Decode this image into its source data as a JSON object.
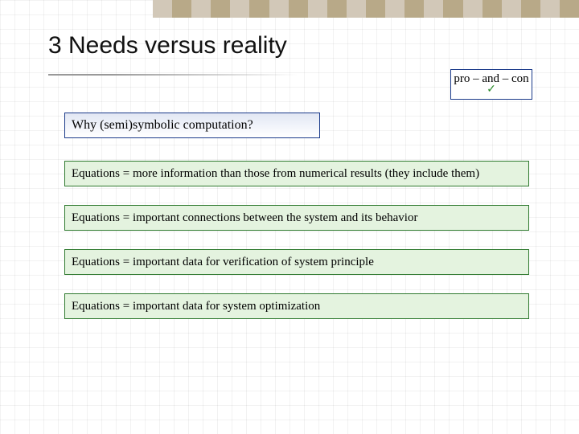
{
  "title": "3 Needs versus reality",
  "procon": {
    "label": "pro – and – con",
    "mark": "✓"
  },
  "question": "Why (semi)symbolic computation?",
  "points": [
    "Equations = more information than those from numerical results (they include them)",
    "Equations = important connections between the system and its behavior",
    "Equations = important data for verification of system principle",
    "Equations = important data for system optimization"
  ]
}
